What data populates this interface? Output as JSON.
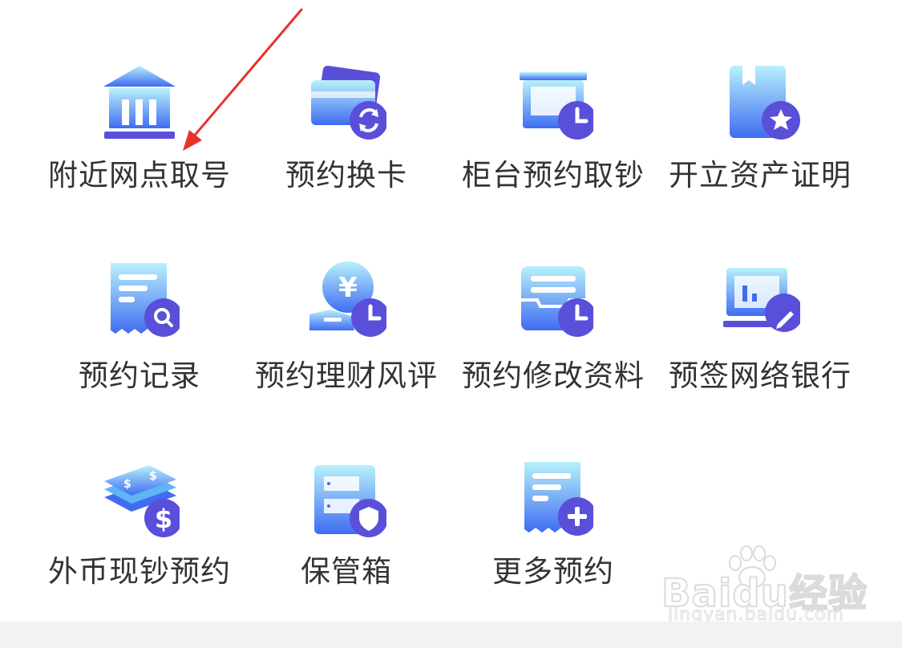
{
  "colors": {
    "icon_light": "#a9ecfb",
    "icon_mid": "#5fb4f5",
    "icon_dark": "#3b62f0",
    "badge": "#5a4fd8",
    "label": "#333333",
    "arrow": "#e8322c",
    "bottom_bar": "#f2f2f4"
  },
  "services": [
    {
      "label": "附近网点取号",
      "icon": "bank-building-icon"
    },
    {
      "label": "预约换卡",
      "icon": "card-exchange-icon"
    },
    {
      "label": "柜台预约取钞",
      "icon": "counter-clock-icon"
    },
    {
      "label": "开立资产证明",
      "icon": "certificate-star-icon"
    },
    {
      "label": "预约记录",
      "icon": "receipt-search-icon"
    },
    {
      "label": "预约理财风评",
      "icon": "yuan-coin-clock-icon"
    },
    {
      "label": "预约修改资料",
      "icon": "drawer-clock-icon"
    },
    {
      "label": "预签网络银行",
      "icon": "screen-pen-icon"
    },
    {
      "label": "外币现钞预约",
      "icon": "cash-stack-dollar-icon"
    },
    {
      "label": "保管箱",
      "icon": "safe-box-shield-icon"
    },
    {
      "label": "更多预约",
      "icon": "receipt-plus-icon"
    }
  ],
  "watermark": {
    "main": "Baidu经验",
    "sub": "jingyan.baidu.com"
  }
}
